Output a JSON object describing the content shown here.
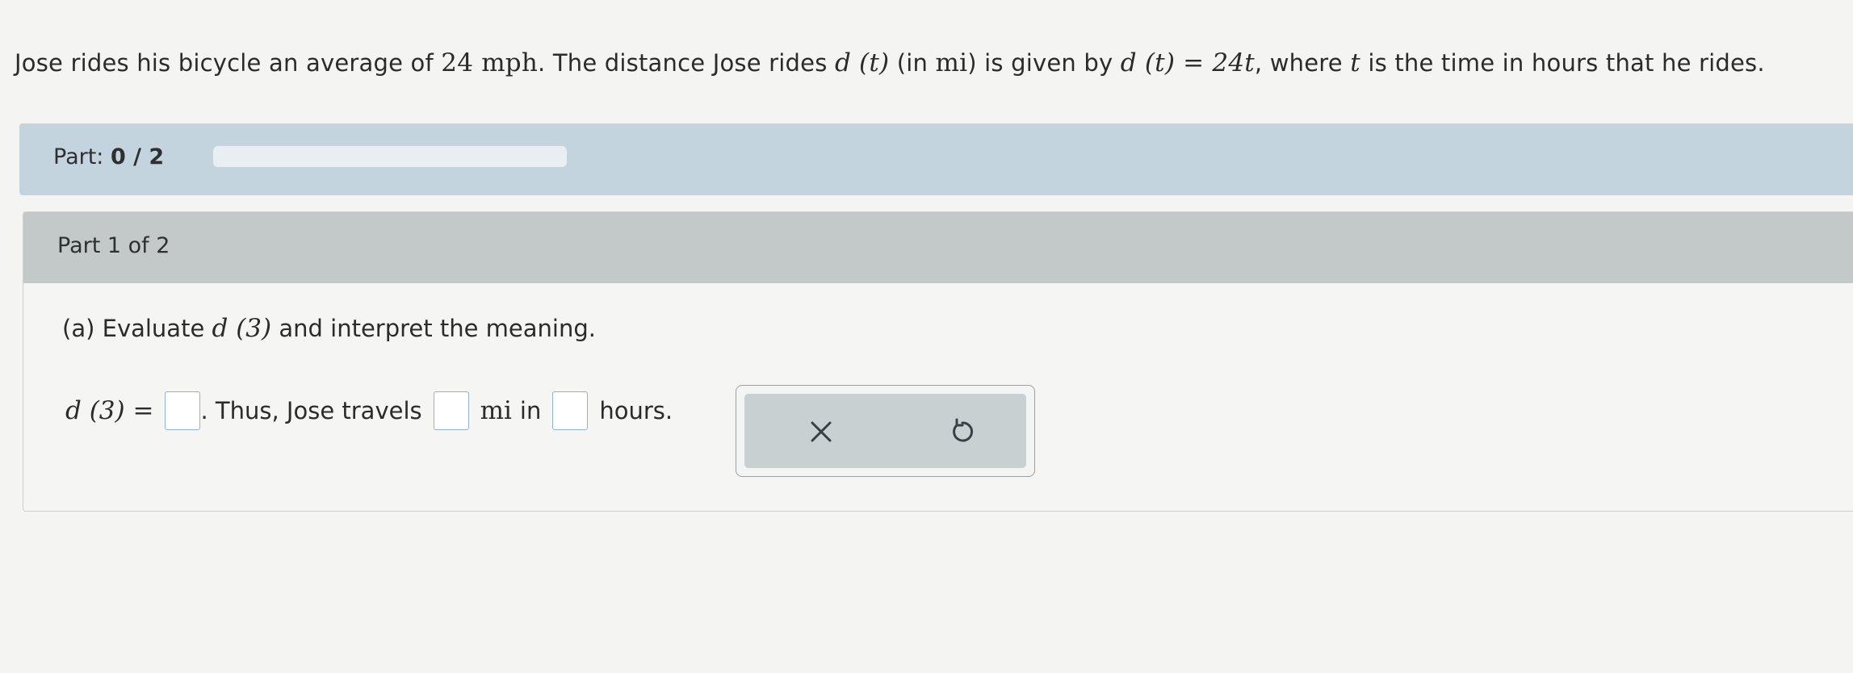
{
  "problem": {
    "t1": "Jose rides his bicycle an average of ",
    "speed": "24 mph",
    "t2": ". The distance Jose rides ",
    "func": "d (t)",
    "t3": " (in ",
    "unit": "mi",
    "t4": ") is given by ",
    "equation": "d (t) = 24t",
    "t5": ", where ",
    "var": "t",
    "t6": " is the time in hours that he rides."
  },
  "progress": {
    "label_prefix": "Part: ",
    "label_value": "0 / 2",
    "fraction": 0
  },
  "part": {
    "header": "Part 1 of 2",
    "question_prefix": "(a) Evaluate ",
    "question_expr": "d (3)",
    "question_suffix": " and interpret the meaning.",
    "answer_lhs": "d (3) =",
    "answer_t1": ". Thus, Jose travels",
    "answer_unit": "mi",
    "answer_t2": "in",
    "answer_t3": "hours.",
    "answers": [
      "",
      "",
      ""
    ]
  },
  "actions": {
    "clear_icon": "x-icon",
    "undo_icon": "undo-icon"
  }
}
